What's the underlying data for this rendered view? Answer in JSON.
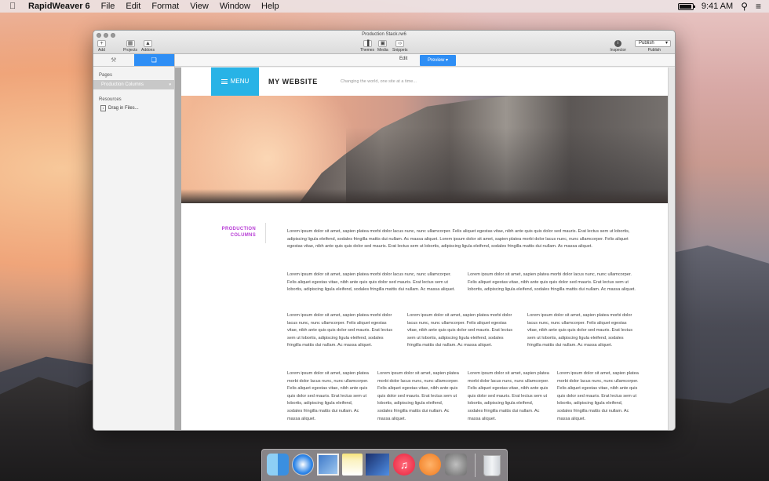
{
  "menubar": {
    "app_name": "RapidWeaver 6",
    "menus": [
      "File",
      "Edit",
      "Format",
      "View",
      "Window",
      "Help"
    ],
    "time": "9:41 AM"
  },
  "window": {
    "title": "Production Stack.rw6",
    "toolbar": {
      "add": "Add",
      "projects": "Projects",
      "addons": "Addons",
      "themes": "Themes",
      "media": "Media",
      "snippets": "Snippets",
      "inspector": "Inspector",
      "publish_button": "Publish",
      "publish_label": "Publish"
    },
    "sidebar": {
      "pages_heading": "Pages",
      "page_item": "Production Columns",
      "resources_heading": "Resources",
      "resource_item": "Drag in Files..."
    },
    "content_tabs": {
      "edit": "Edit",
      "preview": "Preview"
    }
  },
  "website": {
    "menu_label": "MENU",
    "title": "MY WEBSITE",
    "tagline": "Changing the world, one site at a time...",
    "section_label_line1": "PRODUCTION",
    "section_label_line2": "COLUMNS",
    "full_paragraph": "Lorem ipsum dolor sit amet, sapien platea morbi dolor lacus nunc, nunc ullamcorper. Felis aliquet egestas vitae, nibh ante quis quis dolor sed mauris. Erat lectus sem ut lobortis, adipiscing ligula eleifend, sodales fringilla mattis dui nullam. Ac massa aliquet. Lorem ipsum dolor sit amet, sapien platea morbi dolor lacus nunc, nunc ullamcorper. Felis aliquet egestas vitae, nibh ante quis quis dolor sed mauris. Erat lectus sem ut lobortis, adipiscing ligula eleifend, sodales fringilla mattis dui nullam. Ac massa aliquet.",
    "column_paragraph": "Lorem ipsum dolor sit amet, sapien platea morbi dolor lacus nunc, nunc ullamcorper. Felis aliquet egestas vitae, nibh ante quis quis dolor sed mauris. Erat lectus sem ut lobortis, adipiscing ligula eleifend, sodales fringilla mattis dui nullam. Ac massa aliquet."
  },
  "colors": {
    "accent_blue": "#2e8ef5",
    "menu_cyan": "#28b3e6",
    "section_label": "#b83ed6"
  }
}
